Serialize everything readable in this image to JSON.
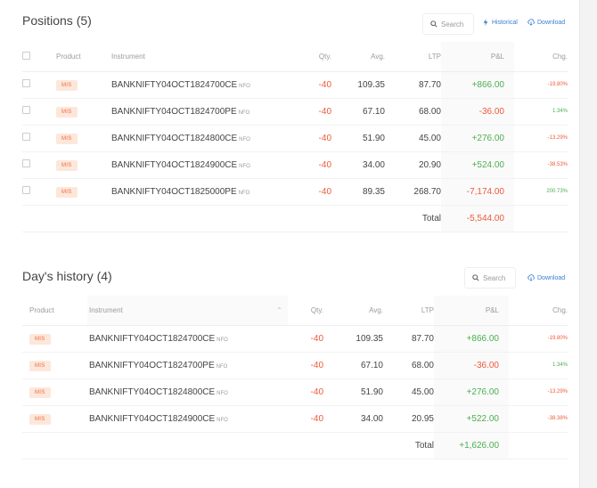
{
  "positions": {
    "title": "Positions (5)",
    "search_placeholder": "Search",
    "historical_label": "Historical",
    "download_label": "Download",
    "columns": {
      "product": "Product",
      "instrument": "Instrument",
      "qty": "Qty.",
      "avg": "Avg.",
      "ltp": "LTP",
      "pnl": "P&L",
      "chg": "Chg."
    },
    "rows": [
      {
        "product": "MIS",
        "instrument": "BANKNIFTY04OCT1824700CE",
        "exchange": "NFO",
        "qty": "-40",
        "avg": "109.35",
        "ltp": "87.70",
        "pnl": "+866.00",
        "chg": "-19.80%"
      },
      {
        "product": "MIS",
        "instrument": "BANKNIFTY04OCT1824700PE",
        "exchange": "NFO",
        "qty": "-40",
        "avg": "67.10",
        "ltp": "68.00",
        "pnl": "-36.00",
        "chg": "1.34%"
      },
      {
        "product": "MIS",
        "instrument": "BANKNIFTY04OCT1824800CE",
        "exchange": "NFO",
        "qty": "-40",
        "avg": "51.90",
        "ltp": "45.00",
        "pnl": "+276.00",
        "chg": "-13.29%"
      },
      {
        "product": "MIS",
        "instrument": "BANKNIFTY04OCT1824900CE",
        "exchange": "NFO",
        "qty": "-40",
        "avg": "34.00",
        "ltp": "20.90",
        "pnl": "+524.00",
        "chg": "-38.53%"
      },
      {
        "product": "MIS",
        "instrument": "BANKNIFTY04OCT1825000PE",
        "exchange": "NFO",
        "qty": "-40",
        "avg": "89.35",
        "ltp": "268.70",
        "pnl": "-7,174.00",
        "chg": "200.73%"
      }
    ],
    "total_label": "Total",
    "total_value": "-5,544.00"
  },
  "history": {
    "title": "Day's history (4)",
    "search_placeholder": "Search",
    "download_label": "Download",
    "columns": {
      "product": "Product",
      "instrument": "Instrument",
      "qty": "Qty.",
      "avg": "Avg.",
      "ltp": "LTP",
      "pnl": "P&L",
      "chg": "Chg."
    },
    "rows": [
      {
        "product": "MIS",
        "instrument": "BANKNIFTY04OCT1824700CE",
        "exchange": "NFO",
        "qty": "-40",
        "avg": "109.35",
        "ltp": "87.70",
        "pnl": "+866.00",
        "chg": "-19.80%"
      },
      {
        "product": "MIS",
        "instrument": "BANKNIFTY04OCT1824700PE",
        "exchange": "NFO",
        "qty": "-40",
        "avg": "67.10",
        "ltp": "68.00",
        "pnl": "-36.00",
        "chg": "1.34%"
      },
      {
        "product": "MIS",
        "instrument": "BANKNIFTY04OCT1824800CE",
        "exchange": "NFO",
        "qty": "-40",
        "avg": "51.90",
        "ltp": "45.00",
        "pnl": "+276.00",
        "chg": "-13.29%"
      },
      {
        "product": "MIS",
        "instrument": "BANKNIFTY04OCT1824900CE",
        "exchange": "NFO",
        "qty": "-40",
        "avg": "34.00",
        "ltp": "20.95",
        "pnl": "+522.00",
        "chg": "-38.38%"
      }
    ],
    "total_label": "Total",
    "total_value": "+1,626.00"
  },
  "colors": {
    "loss": "#ef5a3a",
    "profit": "#4caf50",
    "accent": "#387ed1",
    "badge_bg": "#fde7db",
    "badge_text": "#ef6a3a"
  },
  "icons": {
    "search": "search-icon",
    "historical": "lightning-icon",
    "download": "download-icon",
    "sort": "chevron-up-icon"
  }
}
